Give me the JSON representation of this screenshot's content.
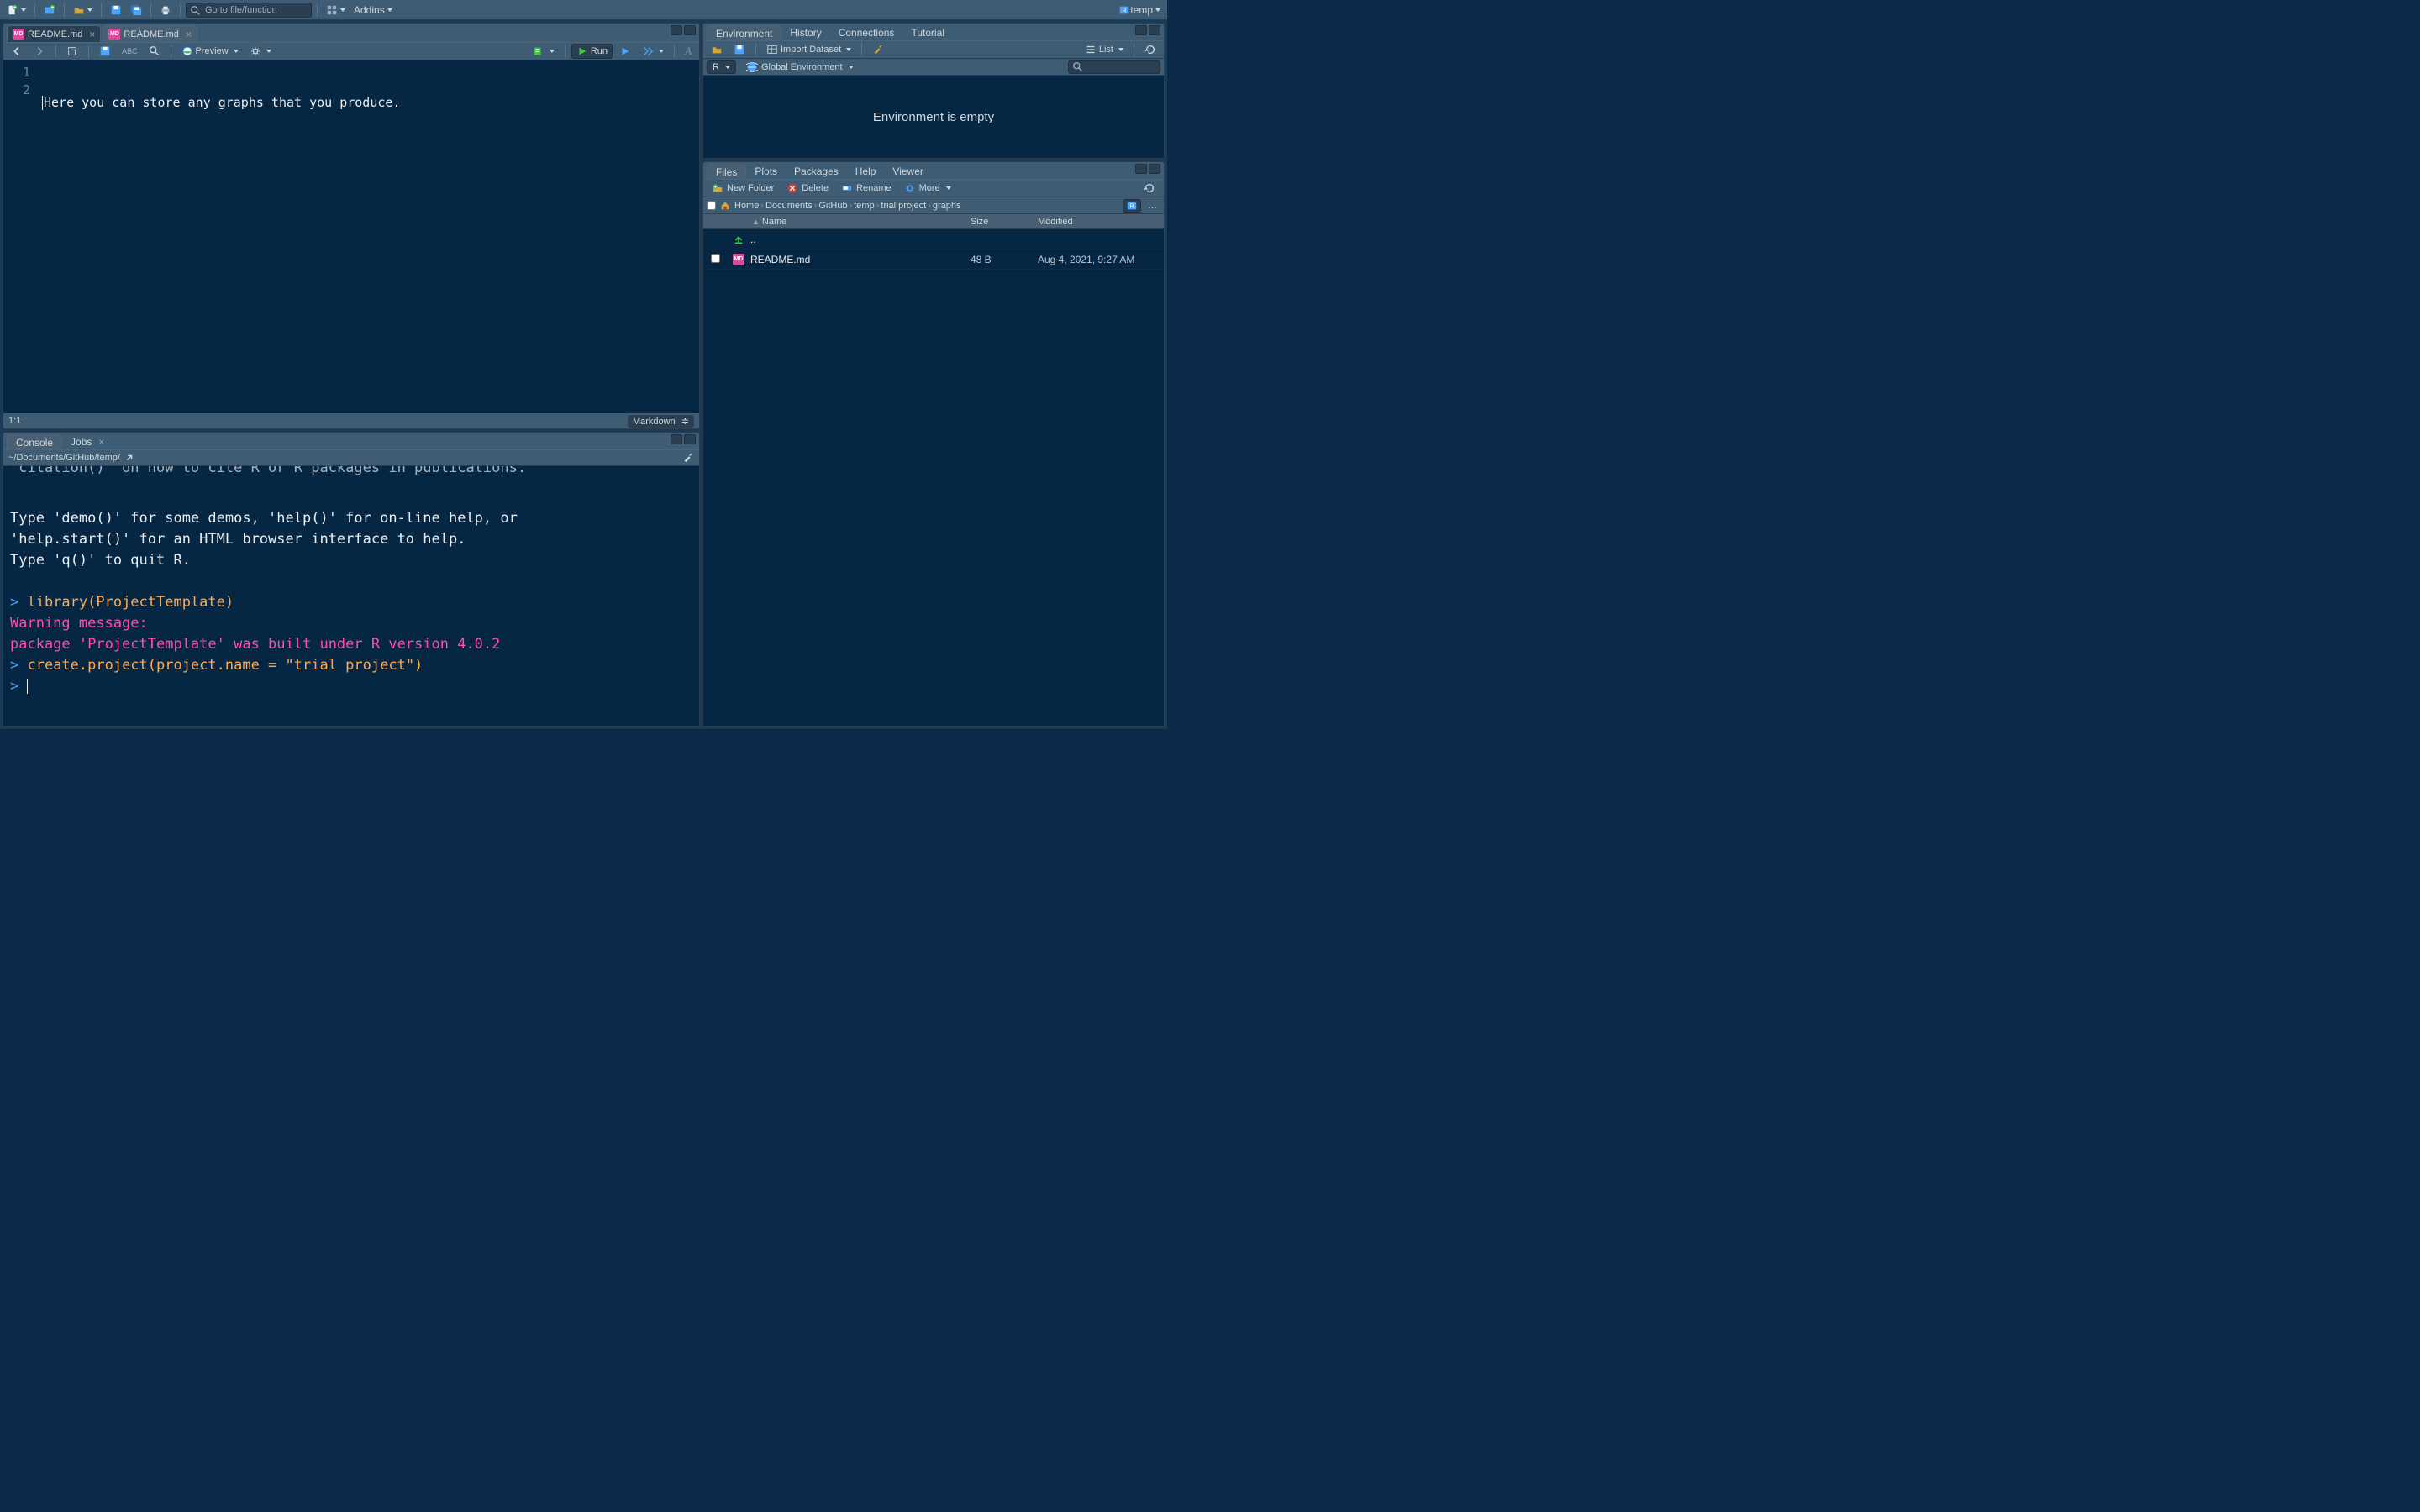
{
  "toolbar": {
    "goto_placeholder": "Go to file/function",
    "addins_label": "Addins",
    "project_name": "temp"
  },
  "source": {
    "tabs": [
      {
        "label": "README.md",
        "active": false
      },
      {
        "label": "README.md",
        "active": true
      }
    ],
    "preview_label": "Preview",
    "run_label": "Run",
    "cursor_pos": "1:1",
    "language": "Markdown",
    "lines": [
      "Here you can store any graphs that you produce.",
      ""
    ]
  },
  "console": {
    "tabs": {
      "console": "Console",
      "jobs": "Jobs"
    },
    "path": "~/Documents/GitHub/temp/",
    "lines": [
      {
        "cls": "c-cut",
        "text": "'citation()' on how to cite R or R packages in publications."
      },
      {
        "cls": "c-white",
        "text": ""
      },
      {
        "cls": "c-white",
        "text": "Type 'demo()' for some demos, 'help()' for on-line help, or"
      },
      {
        "cls": "c-white",
        "text": "'help.start()' for an HTML browser interface to help."
      },
      {
        "cls": "c-white",
        "text": "Type 'q()' to quit R."
      },
      {
        "cls": "c-white",
        "text": ""
      },
      {
        "cls": "c-cmd",
        "text": "library(ProjectTemplate)",
        "prompt": true
      },
      {
        "cls": "c-warn",
        "text": "Warning message:"
      },
      {
        "cls": "c-warn",
        "text": "package 'ProjectTemplate' was built under R version 4.0.2 "
      },
      {
        "cls": "c-cmd",
        "text": "create.project(project.name = \"trial project\")",
        "prompt": true
      },
      {
        "cls": "c-prompt",
        "text": "",
        "prompt": true,
        "cursor": true
      }
    ]
  },
  "env": {
    "tabs": [
      "Environment",
      "History",
      "Connections",
      "Tutorial"
    ],
    "import_label": "Import Dataset",
    "view_label": "List",
    "scope_lang": "R",
    "scope_label": "Global Environment",
    "empty_text": "Environment is empty"
  },
  "files": {
    "tabs": [
      "Files",
      "Plots",
      "Packages",
      "Help",
      "Viewer"
    ],
    "btn_new_folder": "New Folder",
    "btn_delete": "Delete",
    "btn_rename": "Rename",
    "btn_more": "More",
    "breadcrumb": [
      "Home",
      "Documents",
      "GitHub",
      "temp",
      "trial project",
      "graphs"
    ],
    "cols": {
      "name": "Name",
      "size": "Size",
      "modified": "Modified"
    },
    "rows": [
      {
        "up": true,
        "name": "..",
        "size": "",
        "modified": ""
      },
      {
        "icon": "md",
        "name": "README.md",
        "size": "48 B",
        "modified": "Aug 4, 2021, 9:27 AM"
      }
    ]
  }
}
